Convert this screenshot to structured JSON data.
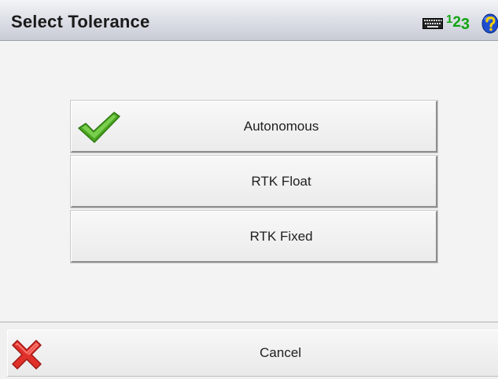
{
  "window": {
    "title": "Select Tolerance"
  },
  "toolbar": {
    "icons": [
      "keyboard-icon",
      "numeric-input-icon",
      "help-icon"
    ],
    "numeric_digits": [
      "1",
      "2",
      "3"
    ],
    "numeric_color": "#11a511",
    "help_color": "#1f4fd0"
  },
  "options": [
    {
      "label": "Autonomous",
      "selected": true
    },
    {
      "label": "RTK Float",
      "selected": false
    },
    {
      "label": "RTK Fixed",
      "selected": false
    }
  ],
  "footer": {
    "cancel_label": "Cancel"
  },
  "colors": {
    "check": "#5cbf2a",
    "cancel_x": "#e0302a"
  }
}
